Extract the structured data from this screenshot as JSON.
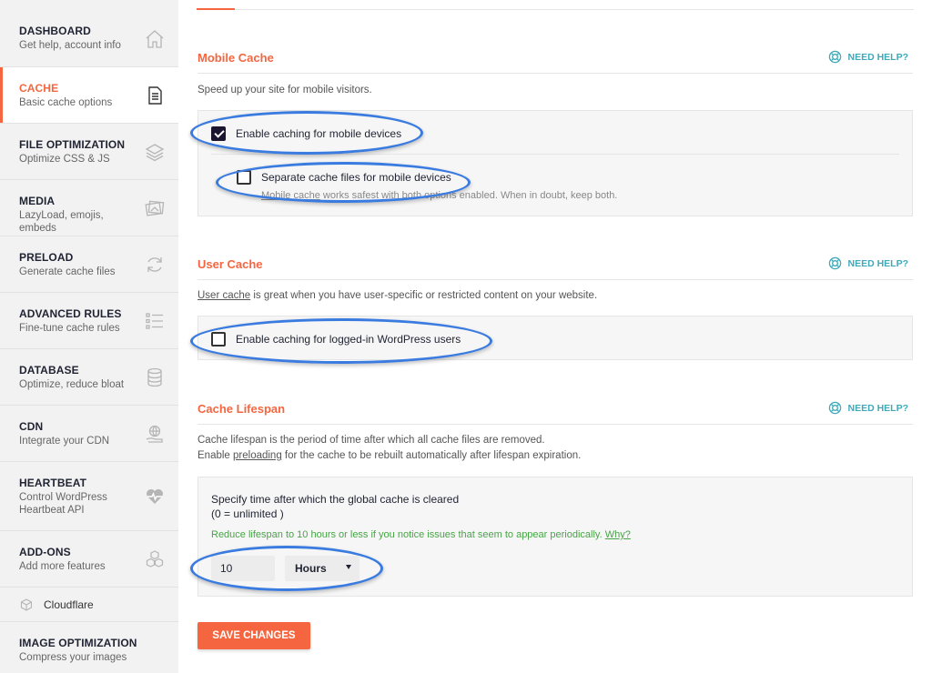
{
  "sidebar": {
    "items": [
      {
        "title": "DASHBOARD",
        "sub": "Get help, account info",
        "icon": "home-icon"
      },
      {
        "title": "CACHE",
        "sub": "Basic cache options",
        "icon": "document-icon"
      },
      {
        "title": "FILE OPTIMIZATION",
        "sub": "Optimize CSS & JS",
        "icon": "layers-icon"
      },
      {
        "title": "MEDIA",
        "sub": "LazyLoad, emojis, embeds",
        "icon": "images-icon"
      },
      {
        "title": "PRELOAD",
        "sub": "Generate cache files",
        "icon": "refresh-icon"
      },
      {
        "title": "ADVANCED RULES",
        "sub": "Fine-tune cache rules",
        "icon": "list-icon"
      },
      {
        "title": "DATABASE",
        "sub": "Optimize, reduce bloat",
        "icon": "database-icon"
      },
      {
        "title": "CDN",
        "sub": "Integrate your CDN",
        "icon": "globe-hand-icon"
      },
      {
        "title": "HEARTBEAT",
        "sub": "Control WordPress Heartbeat API",
        "icon": "heartbeat-icon"
      },
      {
        "title": "ADD-ONS",
        "sub": "Add more features",
        "icon": "cubes-icon"
      }
    ],
    "cloudflare": "Cloudflare",
    "image_opt": {
      "title": "IMAGE OPTIMIZATION",
      "sub": "Compress your images"
    }
  },
  "mobile_cache": {
    "title": "Mobile Cache",
    "help": "NEED HELP?",
    "description": "Speed up your site for mobile visitors.",
    "enable_label": "Enable caching for mobile devices",
    "enable_checked": true,
    "separate_label": "Separate cache files for mobile devices",
    "separate_checked": false,
    "note_link": "Mobile cache",
    "note_rest": " works safest with both options enabled. When in doubt, keep both."
  },
  "user_cache": {
    "title": "User Cache",
    "help": "NEED HELP?",
    "desc_link": "User cache",
    "desc_rest": " is great when you have user-specific or restricted content on your website.",
    "enable_label": "Enable caching for logged-in WordPress users",
    "enable_checked": false
  },
  "cache_lifespan": {
    "title": "Cache Lifespan",
    "help": "NEED HELP?",
    "desc_line1": "Cache lifespan is the period of time after which all cache files are removed.",
    "desc_line2_pre": "Enable ",
    "desc_line2_link": "preloading",
    "desc_line2_post": " for the cache to be rebuilt automatically after lifespan expiration.",
    "field_label": "Specify time after which the global cache is cleared",
    "field_hint": "(0 = unlimited )",
    "green_note": "Reduce lifespan to 10 hours or less if you notice issues that seem to appear periodically. ",
    "green_link": "Why?",
    "value": "10",
    "unit": "Hours"
  },
  "save_label": "SAVE CHANGES",
  "colors": {
    "accent": "#f56640",
    "help": "#40a8b8",
    "highlight": "#3a7be0",
    "note_green": "#47a447"
  }
}
